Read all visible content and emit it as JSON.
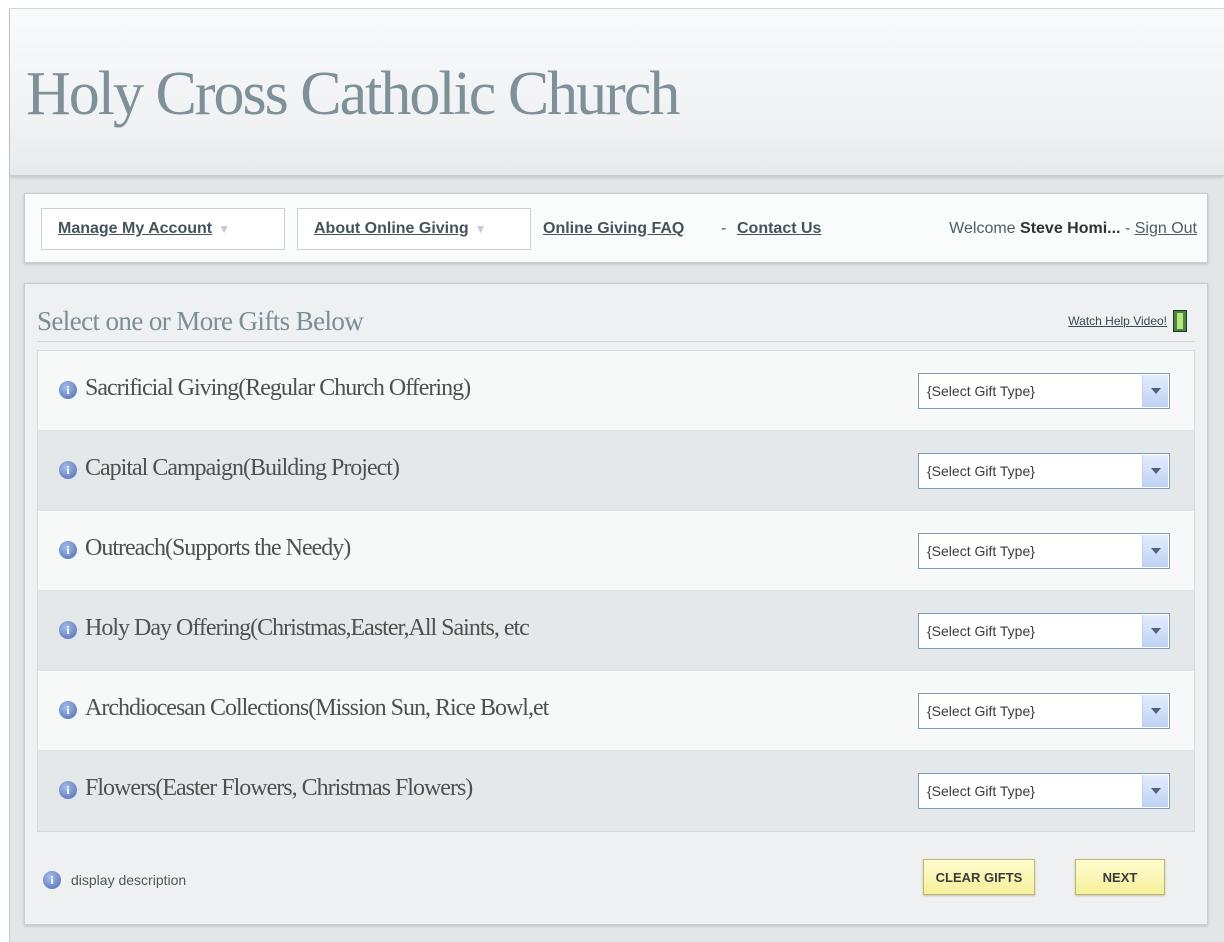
{
  "header": {
    "title": "Holy Cross Catholic Church"
  },
  "nav": {
    "manage_account": "Manage My Account",
    "about_giving": "About Online Giving",
    "faq": "Online Giving FAQ",
    "separator": "-",
    "contact": "Contact Us",
    "welcome_prefix": "Welcome",
    "user_name": "Steve Homi...",
    "signout_sep": "-",
    "signout": "Sign Out"
  },
  "panel": {
    "title": "Select one or More Gifts Below",
    "help_video": "Watch Help Video!",
    "select_placeholder": "{Select Gift Type}",
    "gifts": [
      {
        "label": "Sacrificial Giving(Regular Church Offering)",
        "select": "{Select Gift Type}"
      },
      {
        "label": "Capital Campaign(Building Project)",
        "select": "{Select Gift Type}"
      },
      {
        "label": "Outreach(Supports the Needy)",
        "select": "{Select Gift Type}"
      },
      {
        "label": "Holy Day Offering(Christmas,Easter,All Saints, etc",
        "select": "{Select Gift Type}"
      },
      {
        "label": "Archdiocesan Collections(Mission Sun, Rice Bowl,et",
        "select": "{Select Gift Type}"
      },
      {
        "label": "Flowers(Easter Flowers, Christmas Flowers)",
        "select": "{Select Gift Type}"
      }
    ],
    "legend": "display description",
    "clear_gifts": "CLEAR GIFTS",
    "next": "NEXT"
  },
  "icons": {
    "info": "info-icon",
    "film": "film-icon",
    "dropdown": "chevron-down-icon"
  },
  "colors": {
    "title": "#7e9198",
    "button_bg": "#f7f09b",
    "select_border": "#7f9db9"
  }
}
